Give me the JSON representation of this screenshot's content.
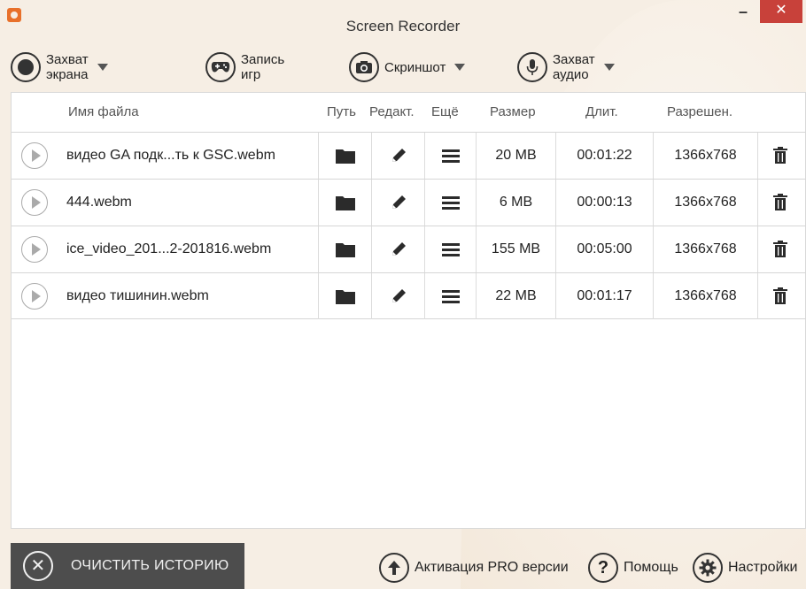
{
  "window": {
    "title": "Screen Recorder",
    "minimize_glyph": "–",
    "close_glyph": "✕"
  },
  "toolbar": {
    "screen_capture": "Захват экрана",
    "game_record": "Запись игр",
    "screenshot": "Скриншот",
    "audio_capture": "Захват аудио"
  },
  "table": {
    "headers": {
      "filename": "Имя файла",
      "path": "Путь",
      "edit": "Редакт.",
      "more": "Ещё",
      "size": "Размер",
      "duration": "Длит.",
      "resolution": "Разрешен."
    },
    "rows": [
      {
        "name": "видео GA подк...ть к GSC.webm",
        "size": "20 MB",
        "duration": "00:01:22",
        "resolution": "1366x768"
      },
      {
        "name": "444.webm",
        "size": "6 MB",
        "duration": "00:00:13",
        "resolution": "1366x768"
      },
      {
        "name": "ice_video_201...2-201816.webm",
        "size": "155 MB",
        "duration": "00:05:00",
        "resolution": "1366x768"
      },
      {
        "name": "видео тишинин.webm",
        "size": "22 MB",
        "duration": "00:01:17",
        "resolution": "1366x768"
      }
    ]
  },
  "footer": {
    "clear_history": "ОЧИСТИТЬ ИСТОРИЮ",
    "activate_pro": "Активация PRO версии",
    "help": "Помощь",
    "settings": "Настройки"
  },
  "colors": {
    "background": "#f6eee4",
    "close_button": "#c8413a",
    "clear_button": "#4d4d4d",
    "app_icon": "#e8702a"
  }
}
